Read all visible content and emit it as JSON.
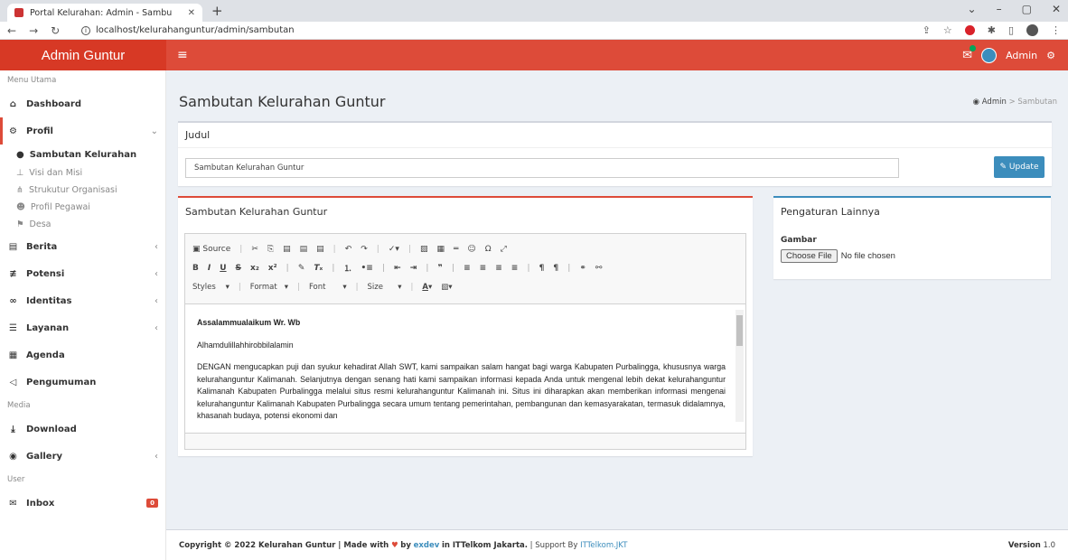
{
  "browser": {
    "tab_title": "Portal Kelurahan: Admin - Sambu",
    "new_tab": "+",
    "url": "localhost/kelurahanguntur/admin/sambutan"
  },
  "topbar": {
    "brand": "Admin Guntur",
    "menu_icon": "≡",
    "user": "Admin"
  },
  "sidebar": {
    "section_main": "Menu Utama",
    "dashboard": "Dashboard",
    "profil": "Profil",
    "sub_items": [
      "Sambutan Kelurahan",
      "Visi dan Misi",
      "Strukutur Organisasi",
      "Profil Pegawai",
      "Desa"
    ],
    "berita": "Berita",
    "potensi": "Potensi",
    "identitas": "Identitas",
    "layanan": "Layanan",
    "agenda": "Agenda",
    "pengumuman": "Pengumuman",
    "section_media": "Media",
    "download": "Download",
    "gallery": "Gallery",
    "section_user": "User",
    "inbox": "Inbox",
    "inbox_badge": "0"
  },
  "page": {
    "title": "Sambutan Kelurahan Guntur",
    "crumb_home": "Admin",
    "crumb_sep": ">",
    "crumb_current": "Sambutan"
  },
  "judul_box": {
    "title": "Judul",
    "value": "Sambutan Kelurahan Guntur",
    "update_btn": "Update"
  },
  "editor_box": {
    "title": "Sambutan Kelurahan Guntur",
    "toolbar": {
      "source": "Source",
      "styles": "Styles",
      "format": "Format",
      "font": "Font",
      "size": "Size"
    },
    "content": {
      "greeting": "Assalammualaikum Wr. Wb",
      "line2": "Alhamdulillahhirobbilalamin",
      "paragraph": "DENGAN mengucapkan puji dan syukur kehadirat Allah SWT, kami sampaikan salam hangat bagi warga Kabupaten Purbalingga, khususnya warga kelurahanguntur Kalimanah. Selanjutnya dengan senang hati kami sampaikan informasi kepada Anda untuk mengenal lebih dekat kelurahanguntur Kalimanah Kabupaten Purbalingga melalui situs resmi kelurahanguntur Kalimanah ini. Situs ini diharapkan akan memberikan informasi mengenai kelurahanguntur Kalimanah Kabupaten Purbalingga secara umum tentang pemerintahan, pembangunan dan kemasyarakatan, termasuk didalamnya, khasanah budaya, potensi ekonomi dan"
    }
  },
  "settings_box": {
    "title": "Pengaturan Lainnya",
    "gambar_label": "Gambar",
    "file_btn": "Choose File",
    "file_status": "No file chosen"
  },
  "footer": {
    "copyright_pre": "Copyright © 2022 Kelurahan Guntur | Made with",
    "by": "by",
    "author": "exdev",
    "in": "in ITTelkom Jakarta.",
    "support": "| Support By",
    "support_link": "ITTelkom.JKT",
    "version_label": "Version",
    "version": "1.0"
  }
}
